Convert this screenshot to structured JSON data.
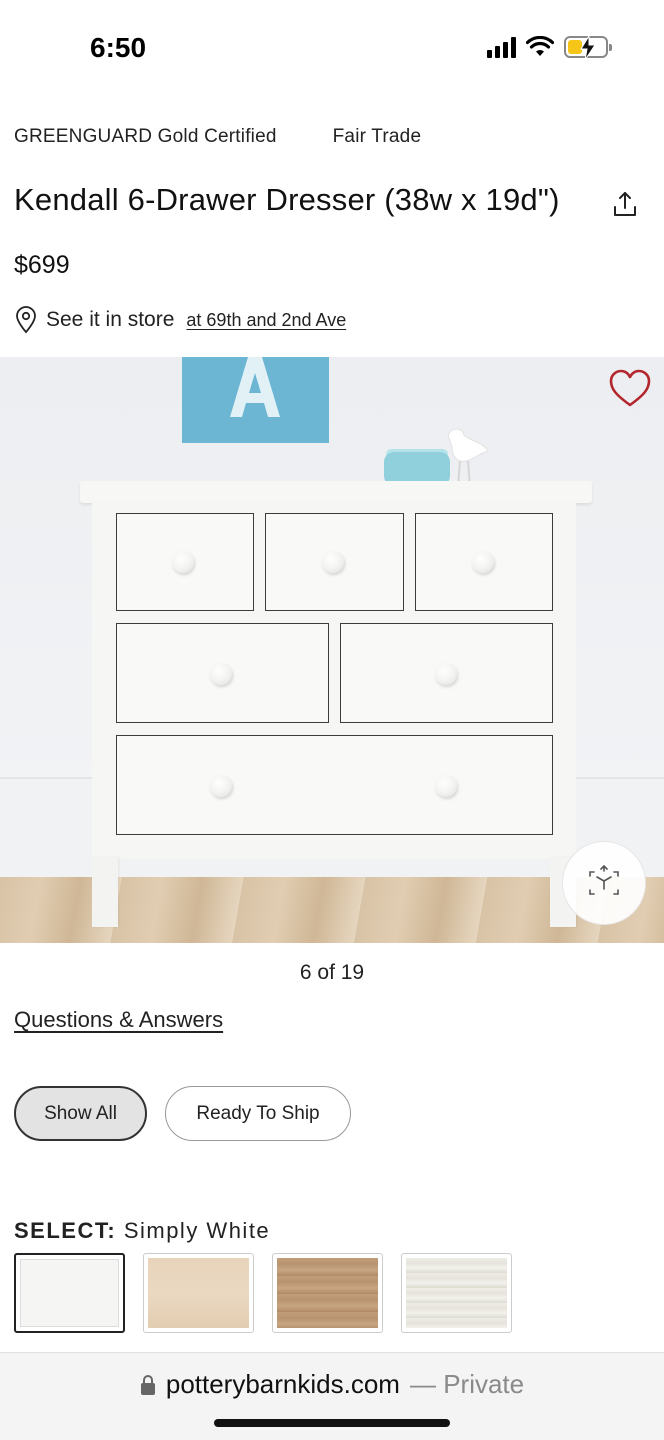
{
  "status_bar": {
    "time": "6:50",
    "icons": [
      "cellular-signal-icon",
      "wifi-icon",
      "battery-charging-icon"
    ],
    "battery_color": "#f5c518"
  },
  "product": {
    "badges": [
      "GREENGUARD Gold Certified",
      "Fair Trade"
    ],
    "title": "Kendall 6-Drawer Dresser (38w x 19d\")",
    "price": "$699",
    "store": {
      "label": "See it in store",
      "location_link": "at 69th and 2nd Ave"
    }
  },
  "gallery": {
    "counter": "6 of 19",
    "favorite_icon_color": "#b3262d",
    "ar_icon": "ar-view-icon"
  },
  "qa_link": "Questions & Answers",
  "filters": {
    "chips": [
      {
        "label": "Show All",
        "active": true
      },
      {
        "label": "Ready To Ship",
        "active": false
      }
    ]
  },
  "select": {
    "key": "SELECT:",
    "value": "Simply White",
    "swatches": [
      {
        "name": "Simply White",
        "selected": true
      },
      {
        "name": "natural",
        "selected": false
      },
      {
        "name": "oak",
        "selected": false
      },
      {
        "name": "weathered white",
        "selected": false
      }
    ]
  },
  "browser": {
    "domain": "potterybarnkids.com",
    "mode": "— Private"
  }
}
